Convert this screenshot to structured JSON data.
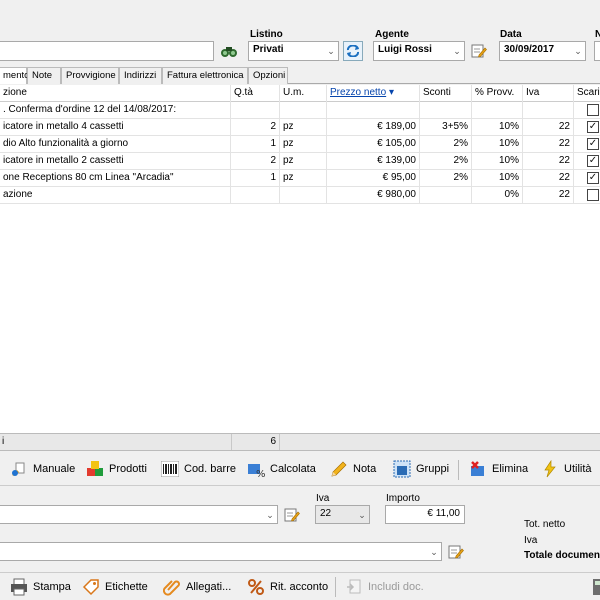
{
  "header": {
    "listino_label": "Listino",
    "listino_value": "Privati",
    "agente_label": "Agente",
    "agente_value": "Luigi Rossi",
    "data_label": "Data",
    "data_value": "30/09/2017",
    "cut_label": "N"
  },
  "tabs": [
    "mento",
    "Note",
    "Provvigione",
    "Indirizzi",
    "Fattura elettronica",
    "Opzioni"
  ],
  "grid": {
    "columns": [
      "zione",
      "Q.tà",
      "U.m.",
      "Prezzo netto",
      "Sconti",
      "% Provv.",
      "Iva",
      "Scario"
    ],
    "sort_indicator": "▾",
    "rows": [
      {
        "desc": ". Conferma d'ordine 12 del 14/08/2017:",
        "qty": "",
        "um": "",
        "price": "",
        "disc": "",
        "prov": "",
        "iva": "",
        "checked": false
      },
      {
        "desc": "icatore in metallo 4 cassetti",
        "qty": "2",
        "um": "pz",
        "price": "€ 189,00",
        "disc": "3+5%",
        "prov": "10%",
        "iva": "22",
        "checked": true
      },
      {
        "desc": "dio Alto funzionalità a giorno",
        "qty": "1",
        "um": "pz",
        "price": "€ 105,00",
        "disc": "2%",
        "prov": "10%",
        "iva": "22",
        "checked": true
      },
      {
        "desc": "icatore in metallo 2 cassetti",
        "qty": "2",
        "um": "pz",
        "price": "€ 139,00",
        "disc": "2%",
        "prov": "10%",
        "iva": "22",
        "checked": true
      },
      {
        "desc": "one Receptions 80 cm Linea \"Arcadia\"",
        "qty": "1",
        "um": "pz",
        "price": "€ 95,00",
        "disc": "2%",
        "prov": "10%",
        "iva": "22",
        "checked": true
      },
      {
        "desc": "azione",
        "qty": "",
        "um": "",
        "price": "€ 980,00",
        "disc": "",
        "prov": "0%",
        "iva": "22",
        "checked": false
      }
    ]
  },
  "summary": {
    "label": "i",
    "qty_total": "6"
  },
  "toolbar": {
    "manuale": "Manuale",
    "prodotti": "Prodotti",
    "cod_barre": "Cod. barre",
    "calcolata": "Calcolata",
    "nota": "Nota",
    "gruppi": "Gruppi",
    "elimina": "Elimina",
    "utilita": "Utilità"
  },
  "entry": {
    "iva_label": "Iva",
    "iva_value": "22",
    "importo_label": "Importo",
    "importo_value": "€ 11,00",
    "tot_netto": "Tot. netto",
    "iva": "Iva",
    "totale": "Totale documen"
  },
  "bottombar": {
    "stampa": "Stampa",
    "etichette": "Etichette",
    "allegati": "Allegati...",
    "rit_acconto": "Rit. acconto",
    "includi_doc": "Includi doc."
  }
}
